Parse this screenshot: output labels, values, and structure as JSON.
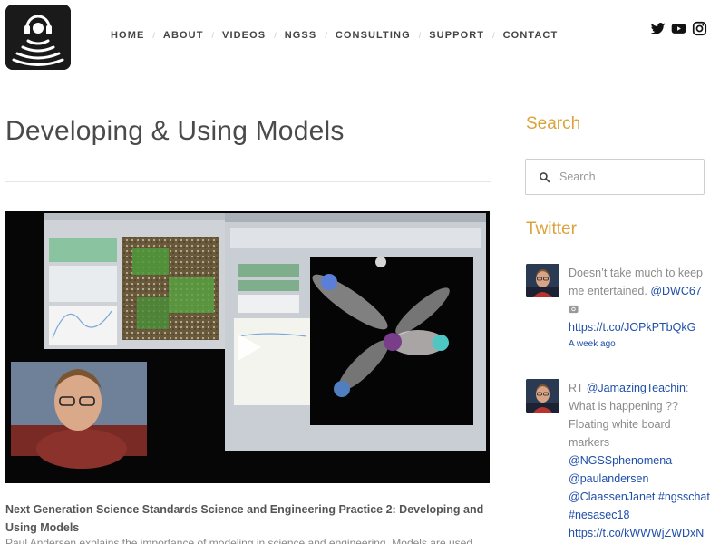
{
  "nav": {
    "items": [
      "HOME",
      "ABOUT",
      "VIDEOS",
      "NGSS",
      "CONSULTING",
      "SUPPORT",
      "CONTACT"
    ],
    "separator": "/"
  },
  "social": {
    "icons": [
      "twitter-icon",
      "youtube-icon",
      "instagram-icon"
    ]
  },
  "main": {
    "title": "Developing & Using Models",
    "video_caption": "Next Generation Science Standards Science and Engineering Practice 2: Developing and Using Models",
    "description": "Paul Andersen explains the importance of modeling in science and engineering. Models are used"
  },
  "sidebar": {
    "search_heading": "Search",
    "search_placeholder": "Search",
    "twitter_heading": "Twitter",
    "tweets": [
      {
        "text": "Doesn’t take much to keep me entertained. ",
        "mention": "@DWC67",
        "link": "https://t.co/JOPkPTbQkG",
        "time": "A week ago"
      },
      {
        "prefix": "RT ",
        "mention": "@JamazingTeachin",
        "text": ": What is happening ?? Floating white board markers",
        "mentions_2": [
          "@NGSSphenomena",
          "@paulandersen",
          "@ClaassenJanet"
        ],
        "hashtags": [
          "#ngsschat",
          "#nesasec18"
        ],
        "link": "https://t.co/kWWWjZWDxN"
      }
    ]
  },
  "colors": {
    "accent": "#dba33c",
    "link": "#1f4fa8",
    "text": "#555555"
  }
}
